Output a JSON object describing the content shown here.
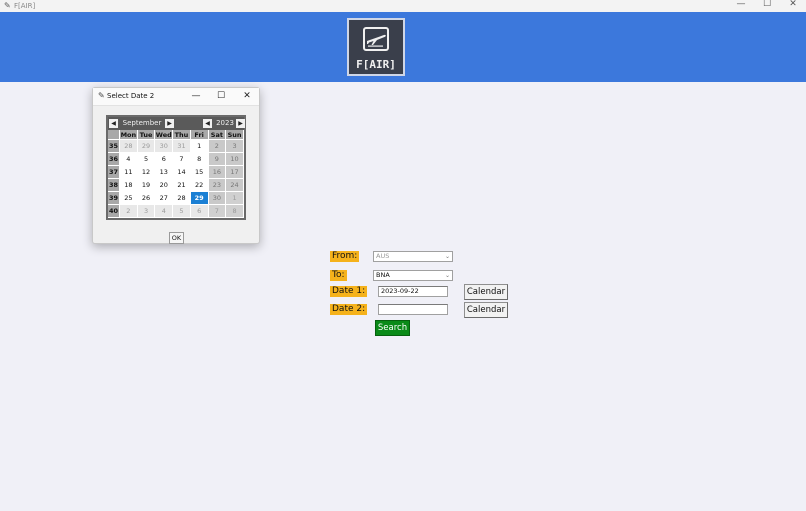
{
  "window": {
    "title": "F[AIR]",
    "controls": [
      "—",
      "☐",
      "✕"
    ]
  },
  "logo": {
    "brand": "F[AIR]"
  },
  "dialog": {
    "title": "Select Date 2",
    "controls": [
      "—",
      "☐",
      "✕"
    ],
    "ok_label": "OK",
    "calendar": {
      "month": "September",
      "year": "2023",
      "weekdays": [
        "Mon",
        "Tue",
        "Wed",
        "Thu",
        "Fri",
        "Sat",
        "Sun"
      ],
      "weeks": [
        {
          "num": "35",
          "days": [
            "28",
            "29",
            "30",
            "31",
            "1",
            "2",
            "3"
          ]
        },
        {
          "num": "36",
          "days": [
            "4",
            "5",
            "6",
            "7",
            "8",
            "9",
            "10"
          ]
        },
        {
          "num": "37",
          "days": [
            "11",
            "12",
            "13",
            "14",
            "15",
            "16",
            "17"
          ]
        },
        {
          "num": "38",
          "days": [
            "18",
            "19",
            "20",
            "21",
            "22",
            "23",
            "24"
          ]
        },
        {
          "num": "39",
          "days": [
            "25",
            "26",
            "27",
            "28",
            "29",
            "30",
            "1"
          ]
        },
        {
          "num": "40",
          "days": [
            "2",
            "3",
            "4",
            "5",
            "6",
            "7",
            "8"
          ]
        }
      ],
      "selected_day": "29"
    }
  },
  "form": {
    "from_label": "From:",
    "from_value": "AUS",
    "to_label": "To:",
    "to_value": "BNA",
    "date1_label": "Date 1:",
    "date1_value": "2023-09-22",
    "date2_label": "Date 2:",
    "date2_value": "",
    "calendar_label": "Calendar",
    "search_label": "Search"
  },
  "colors": {
    "banner": "#3c78dc",
    "label_bg": "#f5b21b",
    "search_bg": "#0a8a18",
    "selected_day": "#1a7fd4"
  }
}
